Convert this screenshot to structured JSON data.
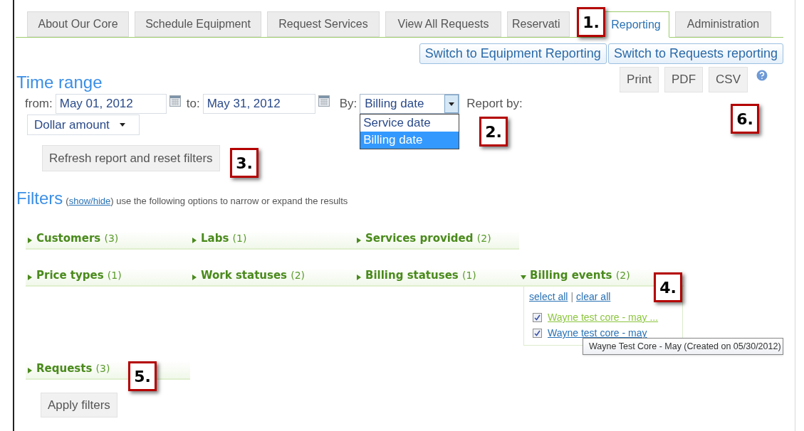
{
  "tabs": [
    {
      "label": "About Our Core",
      "selected": false
    },
    {
      "label": "Schedule Equipment",
      "selected": false
    },
    {
      "label": "Request Services",
      "selected": false
    },
    {
      "label": "View All Requests",
      "selected": false
    },
    {
      "label": "Reservati",
      "selected": false
    },
    {
      "label": "Reporting",
      "selected": true
    },
    {
      "label": "Administration",
      "selected": false
    }
  ],
  "switch_buttons": [
    "Switch to Equipment Reporting",
    "Switch to Requests reporting"
  ],
  "time_range": {
    "title": "Time range",
    "from_label": "from:",
    "from_value": "May 01, 2012",
    "to_label": "to:",
    "to_value": "May 31, 2012",
    "by_label": "By:",
    "by_value": "Billing date",
    "by_options": [
      {
        "label": "Service date",
        "selected": false
      },
      {
        "label": "Billing date",
        "selected": true
      }
    ],
    "report_by_label": "Report by:",
    "report_by_value": "Dollar amount"
  },
  "export_buttons": [
    "Print",
    "PDF",
    "CSV"
  ],
  "refresh_button": "Refresh report and reset filters",
  "filters": {
    "title": "Filters",
    "hint_open": "(",
    "toggle_link": "show/hide",
    "hint": ") use the following options to narrow or expand the results",
    "rows": [
      {
        "items": [
          {
            "label": "Customers",
            "count": "(3)",
            "expanded": false
          },
          {
            "label": "Labs",
            "count": "(1)",
            "expanded": false
          },
          {
            "label": "Services provided",
            "count": "(2)",
            "expanded": false
          }
        ]
      },
      {
        "items": [
          {
            "label": "Price types",
            "count": "(1)",
            "expanded": false
          },
          {
            "label": "Work statuses",
            "count": "(2)",
            "expanded": false
          },
          {
            "label": "Billing statuses",
            "count": "(1)",
            "expanded": false
          },
          {
            "label": "Billing events",
            "count": "(2)",
            "expanded": true,
            "select_all": "select all",
            "separator": "|",
            "clear_all": "clear all",
            "options": [
              {
                "label": "Wayne test core - may ...",
                "checked": true,
                "hovered": true
              },
              {
                "label": "Wayne test core - may",
                "checked": true,
                "hovered": false
              }
            ]
          }
        ]
      },
      {
        "items": [
          {
            "label": "Requests",
            "count": "(3)",
            "expanded": false
          }
        ]
      }
    ]
  },
  "apply_button": "Apply filters",
  "tooltip": "Wayne Test Core - May (Created on 05/30/2012)",
  "callouts": [
    {
      "label": "1."
    },
    {
      "label": "2."
    },
    {
      "label": "3."
    },
    {
      "label": "4."
    },
    {
      "label": "5."
    },
    {
      "label": "6."
    }
  ]
}
